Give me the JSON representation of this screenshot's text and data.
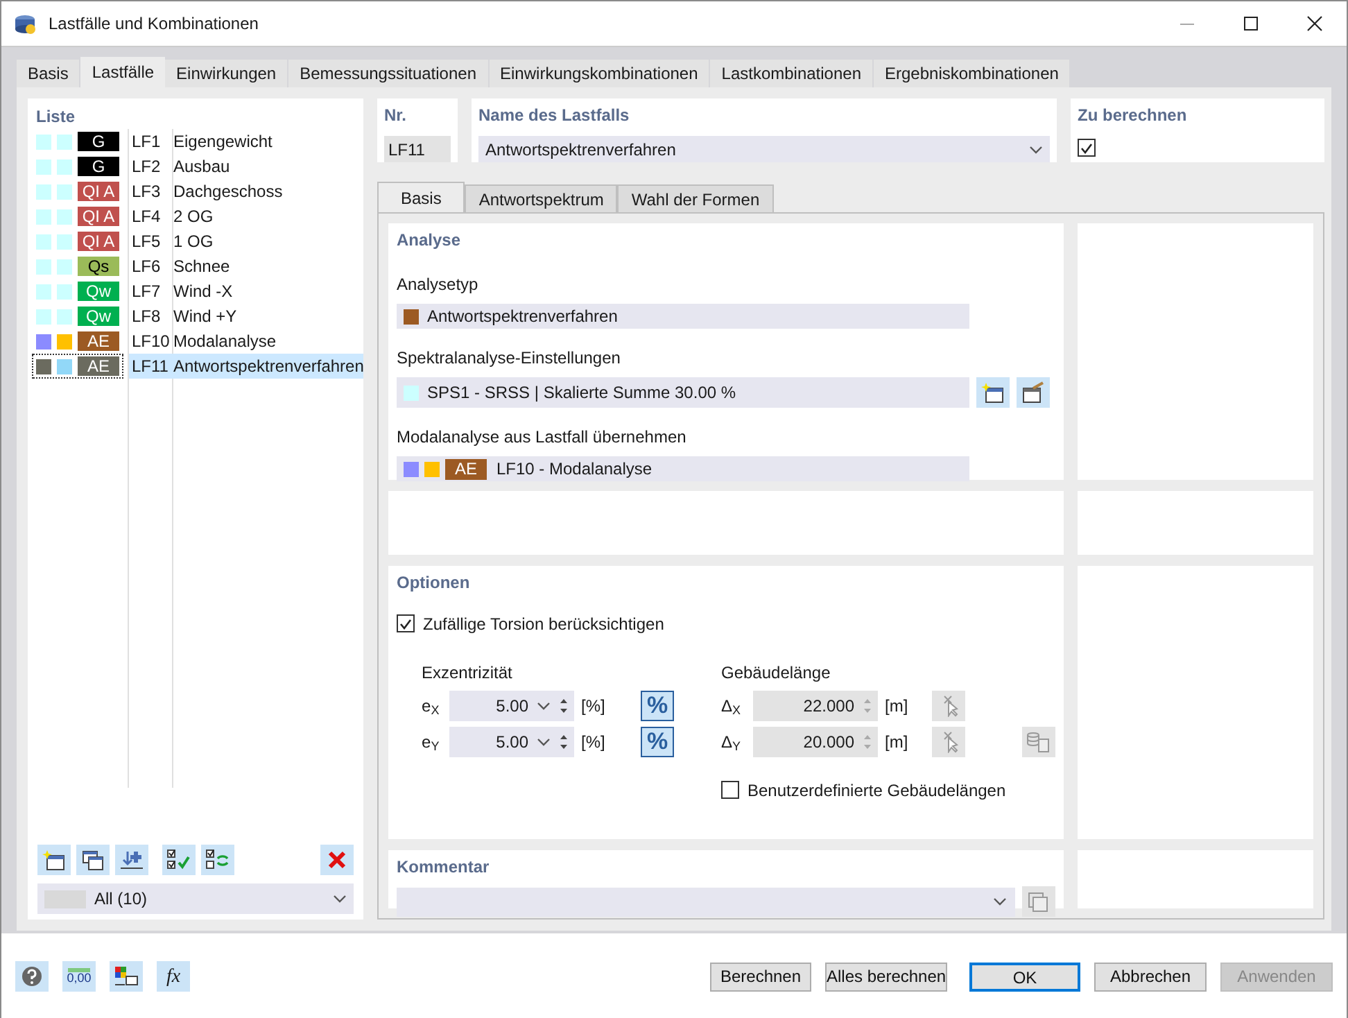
{
  "window": {
    "title": "Lastfälle und Kombinationen"
  },
  "main_tabs": [
    {
      "label": "Basis",
      "selected": false
    },
    {
      "label": "Lastfälle",
      "selected": true
    },
    {
      "label": "Einwirkungen",
      "selected": false
    },
    {
      "label": "Bemessungssituationen",
      "selected": false
    },
    {
      "label": "Einwirkungskombinationen",
      "selected": false
    },
    {
      "label": "Lastkombinationen",
      "selected": false
    },
    {
      "label": "Ergebniskombinationen",
      "selected": false
    }
  ],
  "list": {
    "title": "Liste",
    "items": [
      {
        "swatches": [
          {
            "color": "#ccffff"
          },
          {
            "color": "#ccffff"
          }
        ],
        "badge": {
          "label": "G",
          "color": "#000000"
        },
        "id": "LF1",
        "name": "Eigengewicht",
        "selected": false
      },
      {
        "swatches": [
          {
            "color": "#ccffff"
          },
          {
            "color": "#ccffff"
          }
        ],
        "badge": {
          "label": "G",
          "color": "#000000"
        },
        "id": "LF2",
        "name": "Ausbau",
        "selected": false
      },
      {
        "swatches": [
          {
            "color": "#ccffff"
          },
          {
            "color": "#ccffff"
          }
        ],
        "badge": {
          "label": "QI A",
          "color": "#c0504d"
        },
        "id": "LF3",
        "name": "Dachgeschoss",
        "selected": false
      },
      {
        "swatches": [
          {
            "color": "#ccffff"
          },
          {
            "color": "#ccffff"
          }
        ],
        "badge": {
          "label": "QI A",
          "color": "#c0504d"
        },
        "id": "LF4",
        "name": "2 OG",
        "selected": false
      },
      {
        "swatches": [
          {
            "color": "#ccffff"
          },
          {
            "color": "#ccffff"
          }
        ],
        "badge": {
          "label": "QI A",
          "color": "#c0504d"
        },
        "id": "LF5",
        "name": "1 OG",
        "selected": false
      },
      {
        "swatches": [
          {
            "color": "#ccffff"
          },
          {
            "color": "#ccffff"
          }
        ],
        "badge": {
          "label": "Qs",
          "color": "#9bbb59"
        },
        "id": "LF6",
        "name": "Schnee",
        "selected": false
      },
      {
        "swatches": [
          {
            "color": "#ccffff"
          },
          {
            "color": "#ccffff"
          }
        ],
        "badge": {
          "label": "Qw",
          "color": "#00b050"
        },
        "id": "LF7",
        "name": "Wind -X",
        "selected": false
      },
      {
        "swatches": [
          {
            "color": "#ccffff"
          },
          {
            "color": "#ccffff"
          }
        ],
        "badge": {
          "label": "Qw",
          "color": "#00b050"
        },
        "id": "LF8",
        "name": "Wind +Y",
        "selected": false
      },
      {
        "swatches": [
          {
            "color": "#8b8bff"
          },
          {
            "color": "#ffc000"
          }
        ],
        "badge": {
          "label": "AE",
          "color": "#9c5a23"
        },
        "id": "LF10",
        "name": "Modalanalyse",
        "selected": false
      },
      {
        "swatches": [
          {
            "color": "#6b6b5f"
          },
          {
            "color": "#92d8f8"
          }
        ],
        "badge": {
          "label": "AE",
          "color": "#6b6b5f"
        },
        "id": "LF11",
        "name": "Antwortspektrenverfahren",
        "selected": true
      }
    ],
    "filter": "All (10)"
  },
  "nr": {
    "label": "Nr.",
    "value": "LF11"
  },
  "name_field": {
    "label": "Name des Lastfalls",
    "value": "Antwortspektrenverfahren"
  },
  "to_calculate": {
    "label": "Zu berechnen",
    "checked": true
  },
  "sub_tabs": [
    {
      "label": "Basis",
      "selected": true
    },
    {
      "label": "Antwortspektrum",
      "selected": false
    },
    {
      "label": "Wahl der Formen",
      "selected": false
    }
  ],
  "analysis": {
    "title": "Analyse",
    "analysis_type": {
      "label": "Analysetyp",
      "value": "Antwortspektrenverfahren",
      "color": "#9c5a23"
    },
    "spectral": {
      "label": "Spektralanalyse-Einstellungen",
      "value": "SPS1 - SRSS | Skalierte Summe 30.00 %",
      "color": "#ccffff"
    },
    "modal": {
      "label": "Modalanalyse aus Lastfall übernehmen",
      "swatches": [
        {
          "color": "#8b8bff"
        },
        {
          "color": "#ffc000"
        }
      ],
      "badge": {
        "label": "AE",
        "color": "#9c5a23"
      },
      "value": "LF10 - Modalanalyse"
    }
  },
  "options": {
    "title": "Optionen",
    "torsion": {
      "label": "Zufällige Torsion berücksichtigen",
      "checked": true
    },
    "eccentricity": {
      "title": "Exzentrizität",
      "rows": [
        {
          "symbol": "e$_{X}$",
          "value": "5.00",
          "unit": "[%]",
          "mode": "%"
        },
        {
          "symbol": "e$_{Y}$",
          "value": "5.00",
          "unit": "[%]",
          "mode": "%"
        }
      ]
    },
    "building_length": {
      "title": "Gebäudelänge",
      "rows": [
        {
          "symbol": "Δ$_{X}$",
          "value": "22.000",
          "unit": "[m]"
        },
        {
          "symbol": "Δ$_{Y}$",
          "value": "20.000",
          "unit": "[m]"
        }
      ]
    },
    "custom_lengths": {
      "label": "Benutzerdefinierte Gebäudelängen",
      "checked": false
    }
  },
  "comment": {
    "title": "Kommentar"
  },
  "tool_texts": {
    "units": "0,00",
    "formula": "fx"
  },
  "buttons": [
    {
      "label": "Berechnen",
      "kind": "normal"
    },
    {
      "label": "Alles berechnen",
      "kind": "normal"
    },
    {
      "label": "OK",
      "kind": "default"
    },
    {
      "label": "Abbrechen",
      "kind": "normal"
    },
    {
      "label": "Anwenden",
      "kind": "disabled"
    }
  ]
}
